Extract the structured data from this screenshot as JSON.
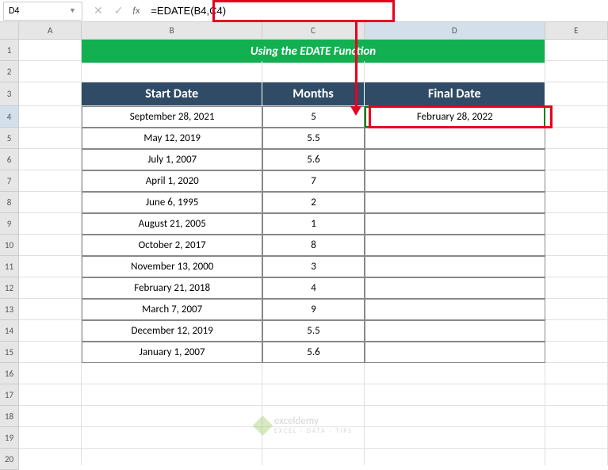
{
  "nameBox": {
    "value": "D4"
  },
  "formulaBar": {
    "formula": "=EDATE(B4,C4)",
    "fxLabel": "fx"
  },
  "columns": [
    "A",
    "B",
    "C",
    "D",
    "E"
  ],
  "rowCount": 20,
  "activeRow": 4,
  "activeCol": "D",
  "title": "Using the EDATE Function",
  "headers": {
    "b": "Start Date",
    "c": "Months",
    "d": "Final Date"
  },
  "chart_data": {
    "type": "table",
    "columns": [
      "Start Date",
      "Months",
      "Final Date"
    ],
    "rows": [
      {
        "start": "September 28, 2021",
        "months": "5",
        "final": "February 28, 2022"
      },
      {
        "start": "May 12, 2019",
        "months": "5.5",
        "final": ""
      },
      {
        "start": "July 1, 2007",
        "months": "5.6",
        "final": ""
      },
      {
        "start": "April 1, 2020",
        "months": "7",
        "final": ""
      },
      {
        "start": "June 6, 1995",
        "months": "2",
        "final": ""
      },
      {
        "start": "August 21, 2005",
        "months": "1",
        "final": ""
      },
      {
        "start": "October 2, 2017",
        "months": "8",
        "final": ""
      },
      {
        "start": "November 13, 2000",
        "months": "3",
        "final": ""
      },
      {
        "start": "February 21, 2018",
        "months": "4",
        "final": ""
      },
      {
        "start": "March 7, 2007",
        "months": "9",
        "final": ""
      },
      {
        "start": "December 12, 2019",
        "months": "5.5",
        "final": ""
      },
      {
        "start": "January 1, 2007",
        "months": "5.6",
        "final": ""
      }
    ]
  },
  "watermark": {
    "brand": "exceldemy",
    "sub": "EXCEL · DATA · TIPS"
  }
}
